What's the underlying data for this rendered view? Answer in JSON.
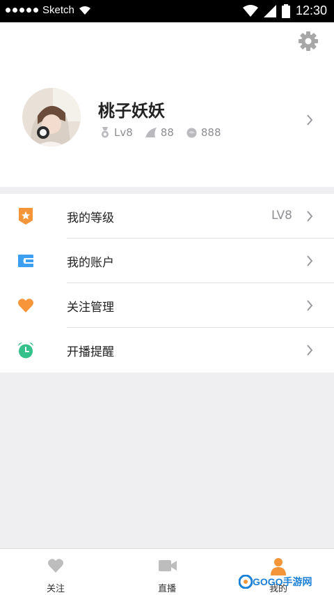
{
  "status_bar": {
    "carrier": "Sketch",
    "time": "12:30"
  },
  "profile": {
    "name": "桃子妖妖",
    "level": "Lv8",
    "stat2": "88",
    "stat3": "888"
  },
  "menu": {
    "items": [
      {
        "label": "我的等级",
        "value": "LV8",
        "icon": "level-badge-icon",
        "color": "#f5953a"
      },
      {
        "label": "我的账户",
        "value": "",
        "icon": "wallet-icon",
        "color": "#3d9ff0"
      },
      {
        "label": "关注管理",
        "value": "",
        "icon": "heart-icon",
        "color": "#f7953b"
      },
      {
        "label": "开播提醒",
        "value": "",
        "icon": "alarm-clock-icon",
        "color": "#35c28a"
      }
    ]
  },
  "tabbar": {
    "tabs": [
      {
        "label": "关注",
        "icon": "heart-icon",
        "active": false
      },
      {
        "label": "直播",
        "icon": "video-camera-icon",
        "active": false
      },
      {
        "label": "我的",
        "icon": "person-icon",
        "active": true
      }
    ]
  },
  "watermark": {
    "text": "GOGO手游网"
  },
  "colors": {
    "accent": "#f5953a",
    "inactive_icon": "#bdbdbd"
  }
}
